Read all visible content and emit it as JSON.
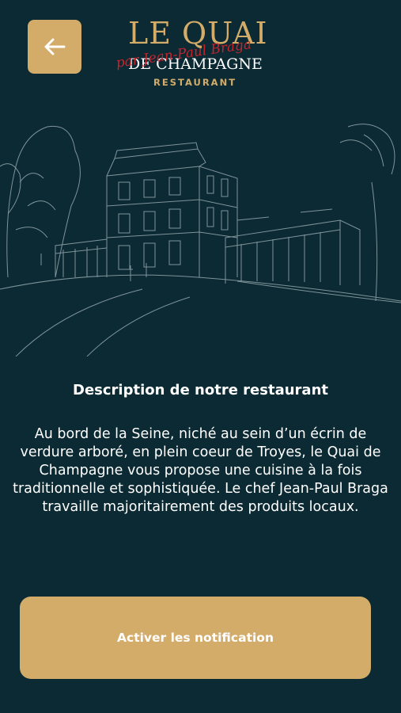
{
  "header": {
    "back_icon": "arrow-left-icon",
    "logo": {
      "line1": "LE QUAI",
      "script": "par Jean-Paul Braga",
      "line2": "DE CHAMPAGNE",
      "sub": "RESTAURANT"
    }
  },
  "content": {
    "title": "Description de notre restaurant",
    "description": "Au bord de la Seine, niché au sein d’un écrin de verdure arboré, en plein coeur de Troyes, le Quai de Champagne vous propose une cuisine à la fois traditionnelle et sophistiquée. Le chef Jean-Paul Braga travaille majoritairement des produits locaux."
  },
  "actions": {
    "notify_label": "Activer les notification"
  },
  "colors": {
    "background": "#0c2a33",
    "accent": "#d4ac6a",
    "logo_script": "#c8232c"
  }
}
